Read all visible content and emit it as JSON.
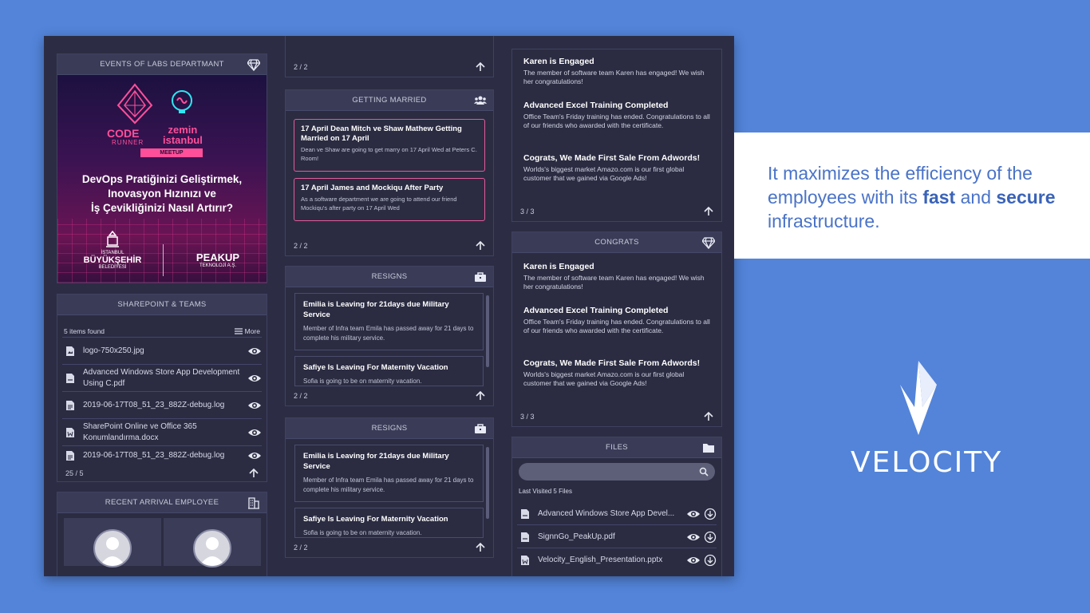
{
  "events": {
    "header": "EVENTS OF LABS DEPARTMANT",
    "banner": {
      "logo_left_line1": "CODE",
      "logo_left_line2": "RUNNER",
      "logo_right_line1": "zemin",
      "logo_right_line2": "istanbul",
      "meetup": "MEETUP",
      "title_line1": "DevOps Pratiğinizi Geliştirmek,",
      "title_line2": "Inovasyon Hızınızı ve",
      "title_line3": "İş Çevikliğinizi Nasıl Artırır?",
      "footer_left_small": "İSTANBUL",
      "footer_left_big": "BÜYÜKŞEHİR",
      "footer_left_sub": "BELEDİYESİ",
      "footer_right_big": "PEAKUP",
      "footer_right_sub": "TEKNOLOJİ A.Ş."
    }
  },
  "sharepoint": {
    "header": "SHAREPOINT & TEAMS",
    "count": "5 items found",
    "more": "More",
    "files": [
      {
        "name": "logo-750x250.jpg"
      },
      {
        "name": "Advanced Windows Store App Development Using C.pdf"
      },
      {
        "name": "2019-06-17T08_51_23_882Z-debug.log"
      },
      {
        "name": "SharePoint Online ve Office 365 Konumlandırma.docx"
      },
      {
        "name": "2019-06-17T08_51_23_882Z-debug.log"
      }
    ],
    "pager": "25 / 5"
  },
  "recent": {
    "header": "RECENT ARRIVAL EMPLOYEE"
  },
  "top_pager": "2 / 2",
  "married": {
    "header": "GETTING MARRIED",
    "cards": [
      {
        "title": "17 April Dean Mitch ve Shaw Mathew Getting Married on 17 April",
        "desc": "Dean ve Shaw are going to get marry on 17 April Wed at Peters C. Room!"
      },
      {
        "title": "17 April James and Mockiqu After Party",
        "desc": "As a software department we are going to attend our friend Mockiqu's after party on 17 April Wed"
      }
    ],
    "pager": "2 / 2"
  },
  "resigns": [
    {
      "header": "RESIGNS",
      "cards": [
        {
          "title": "Emilia is Leaving for 21days due Military Service",
          "desc": "Member of Infra team Emila has passed away for 21 days to complete his military service."
        },
        {
          "title": "Safiye Is Leaving For Maternity Vacation",
          "desc": "Sofia is going to be on maternity vacation."
        }
      ],
      "pager": "2 / 2"
    },
    {
      "header": "RESIGNS",
      "cards": [
        {
          "title": "Emilia is Leaving for 21days due Military Service",
          "desc": "Member of Infra team Emila has passed away for 21 days to complete his military service."
        },
        {
          "title": "Safiye Is Leaving For Maternity Vacation",
          "desc": "Sofia is going to be on maternity vacation."
        }
      ],
      "pager": "2 / 2"
    }
  ],
  "news_top": {
    "items": [
      {
        "title": "Karen is Engaged",
        "desc": "The member of software team Karen has engaged! We wish her congratulations!"
      },
      {
        "title": "Advanced Excel Training Completed",
        "desc": "Office Team's Friday training has ended. Congratulations to all of our friends who awarded with the certificate."
      },
      {
        "title": "Cograts, We Made First Sale From Adwords!",
        "desc": "Worlds's biggest market Amazo.com is our first global customer that we gained via Google Ads!"
      }
    ],
    "pager": "3 / 3"
  },
  "congrats": {
    "header": "CONGRATS",
    "items": [
      {
        "title": "Karen is Engaged",
        "desc": "The member of software team Karen has engaged! We wish her congratulations!"
      },
      {
        "title": "Advanced Excel Training Completed",
        "desc": "Office Team's Friday training has ended. Congratulations to all of our friends who awarded with the certificate."
      },
      {
        "title": "Cograts, We Made First Sale From Adwords!",
        "desc": "Worlds's biggest market Amazo.com is our first global customer that we gained via Google Ads!"
      }
    ],
    "pager": "3 / 3"
  },
  "files": {
    "header": "FILES",
    "search_placeholder": "",
    "last_visited": "Last Visited 5 Files",
    "items": [
      {
        "name": "Advanced Windows Store App Devel..."
      },
      {
        "name": "SignnGo_PeakUp.pdf"
      },
      {
        "name": "Velocity_English_Presentation.pptx"
      }
    ]
  },
  "promo": {
    "text_part1": "It maximizes the efficiency of the employees with its ",
    "bold1": "fast",
    "text_part2": " and ",
    "bold2": "secure",
    "text_part3": " infrastructure.",
    "brand": "VELOCITY"
  },
  "colors": {
    "background": "#5384d9",
    "dashboard": "#2c2d44",
    "accent_pink": "#e25b9c",
    "tagline": "#4a73c8"
  }
}
